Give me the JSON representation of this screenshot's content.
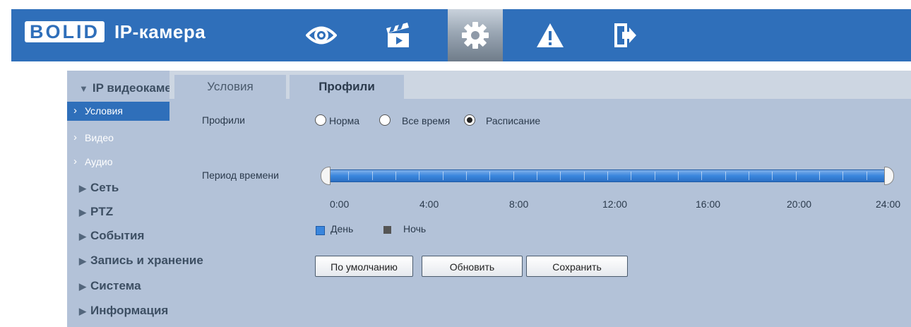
{
  "header": {
    "logo": "BOLID",
    "title": "IP-камера",
    "nav": [
      {
        "icon": "eye-icon"
      },
      {
        "icon": "clapperboard-icon"
      },
      {
        "icon": "gear-icon",
        "active": true
      },
      {
        "icon": "warning-icon"
      },
      {
        "icon": "logout-icon"
      }
    ]
  },
  "sidebar": {
    "sections": [
      {
        "label": "IP видеокамера",
        "expanded": true
      },
      {
        "label": "Сеть"
      },
      {
        "label": "PTZ"
      },
      {
        "label": "События"
      },
      {
        "label": "Запись и хранение"
      },
      {
        "label": "Система"
      },
      {
        "label": "Информация"
      }
    ],
    "sub_items": [
      {
        "label": "Условия",
        "active": true
      },
      {
        "label": "Видео"
      },
      {
        "label": "Аудио"
      }
    ]
  },
  "tabs": [
    {
      "label": "Условия"
    },
    {
      "label": "Профили",
      "active": true
    }
  ],
  "form": {
    "profiles_label": "Профили",
    "radio_options": [
      {
        "label": "Норма",
        "checked": false
      },
      {
        "label": "Все время",
        "checked": false
      },
      {
        "label": "Расписание",
        "checked": true
      }
    ],
    "period_label": "Период времени",
    "time_ticks": [
      "0:00",
      "4:00",
      "8:00",
      "12:00",
      "16:00",
      "20:00",
      "24:00"
    ],
    "schedule": {
      "day_from": "0:00",
      "day_to": "24:00"
    },
    "legend": [
      {
        "label": "День",
        "color": "#3a86dd"
      },
      {
        "label": "Ночь",
        "color": "#555555"
      }
    ]
  },
  "buttons": {
    "default": "По умолчанию",
    "refresh": "Обновить",
    "save": "Сохранить"
  }
}
